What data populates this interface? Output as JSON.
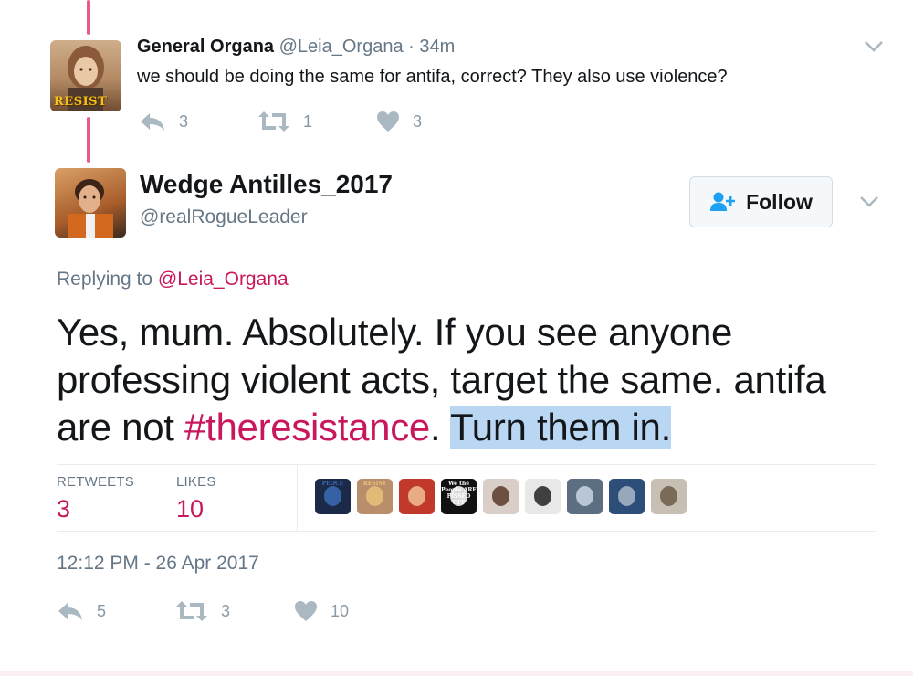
{
  "reply_tweet": {
    "name": "General Organa",
    "handle": "@Leia_Organa",
    "separator": "·",
    "time": "34m",
    "text": "we should be doing the same for antifa, correct? They also use violence?",
    "avatar_badge": "RESIST",
    "reply_count": "3",
    "retweet_count": "1",
    "like_count": "3"
  },
  "main_tweet": {
    "name": "Wedge Antilles_2017",
    "handle": "@realRogueLeader",
    "follow_label": "Follow",
    "replying_prefix": "Replying to",
    "replying_to": "@Leia_Organa",
    "text_part1": "Yes, mum. Absolutely. If you see anyone professing violent acts, target the same. antifa are not ",
    "hashtag": "#theresistance",
    "text_part2": ". ",
    "highlighted": "Turn them in.",
    "retweets_label": "RETWEETS",
    "retweets_value": "3",
    "likes_label": "LIKES",
    "likes_value": "10",
    "timestamp": "12:12 PM - 26 Apr 2017",
    "reply_count": "5",
    "retweet_count": "3",
    "like_count": "10"
  },
  "likers": [
    {
      "label": "PEOCE",
      "color": "#1c2a4a",
      "accent": "#3a6bb5"
    },
    {
      "label": "RESIST",
      "color": "#b98f6b",
      "accent": "#e8c27a"
    },
    {
      "label": "",
      "color": "#c0392b",
      "accent": "#f0c090"
    },
    {
      "label": "We the People ARE PISSED OFF",
      "color": "#111111",
      "accent": "#ffffff"
    },
    {
      "label": "",
      "color": "#d9cfc8",
      "accent": "#5a3a2a"
    },
    {
      "label": "",
      "color": "#e8e8e8",
      "accent": "#222222"
    },
    {
      "label": "",
      "color": "#5c6e82",
      "accent": "#c9d6e3"
    },
    {
      "label": "",
      "color": "#2c4e78",
      "accent": "#aab8c8"
    },
    {
      "label": "",
      "color": "#c8bfb4",
      "accent": "#6d5a48"
    }
  ],
  "colors": {
    "accent": "#c8175d",
    "muted": "#657786",
    "icon": "#aab8c2",
    "highlight": "#b9d7f3"
  },
  "icons": [
    "reply-icon",
    "retweet-icon",
    "heart-icon",
    "chevron-down-icon",
    "add-user-icon"
  ]
}
